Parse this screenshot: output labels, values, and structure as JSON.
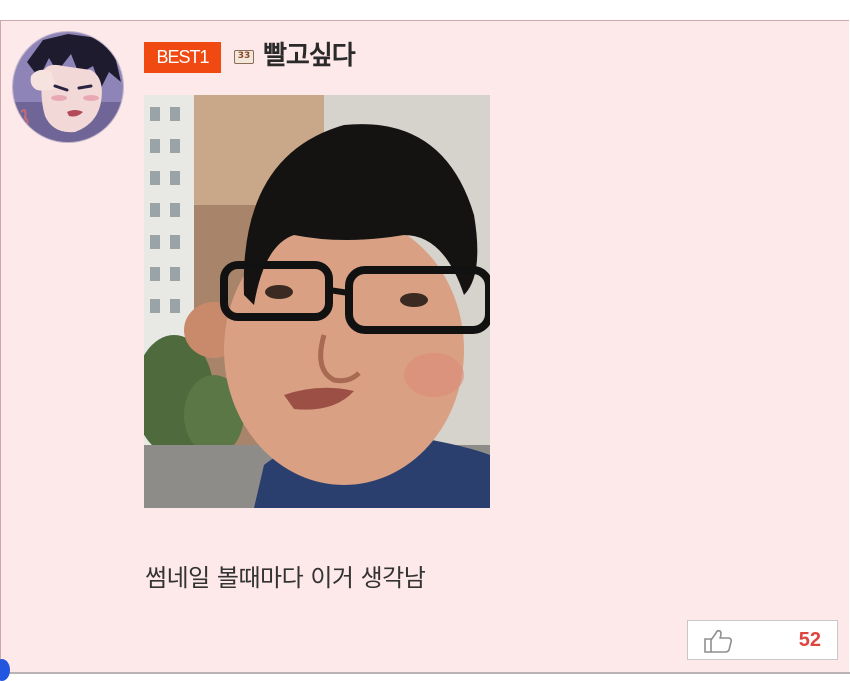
{
  "comment": {
    "badge": "BEST1",
    "level_badge": "33",
    "username": "빨고싶다",
    "text": "썸네일 볼때마다 이거 생각남",
    "likes": "52"
  },
  "icons": {
    "level": "level-badge-icon",
    "like": "thumbs-up-icon"
  },
  "colors": {
    "card_background": "#fde8ea",
    "badge_background": "#f04a12",
    "like_count": "#e0443e"
  }
}
